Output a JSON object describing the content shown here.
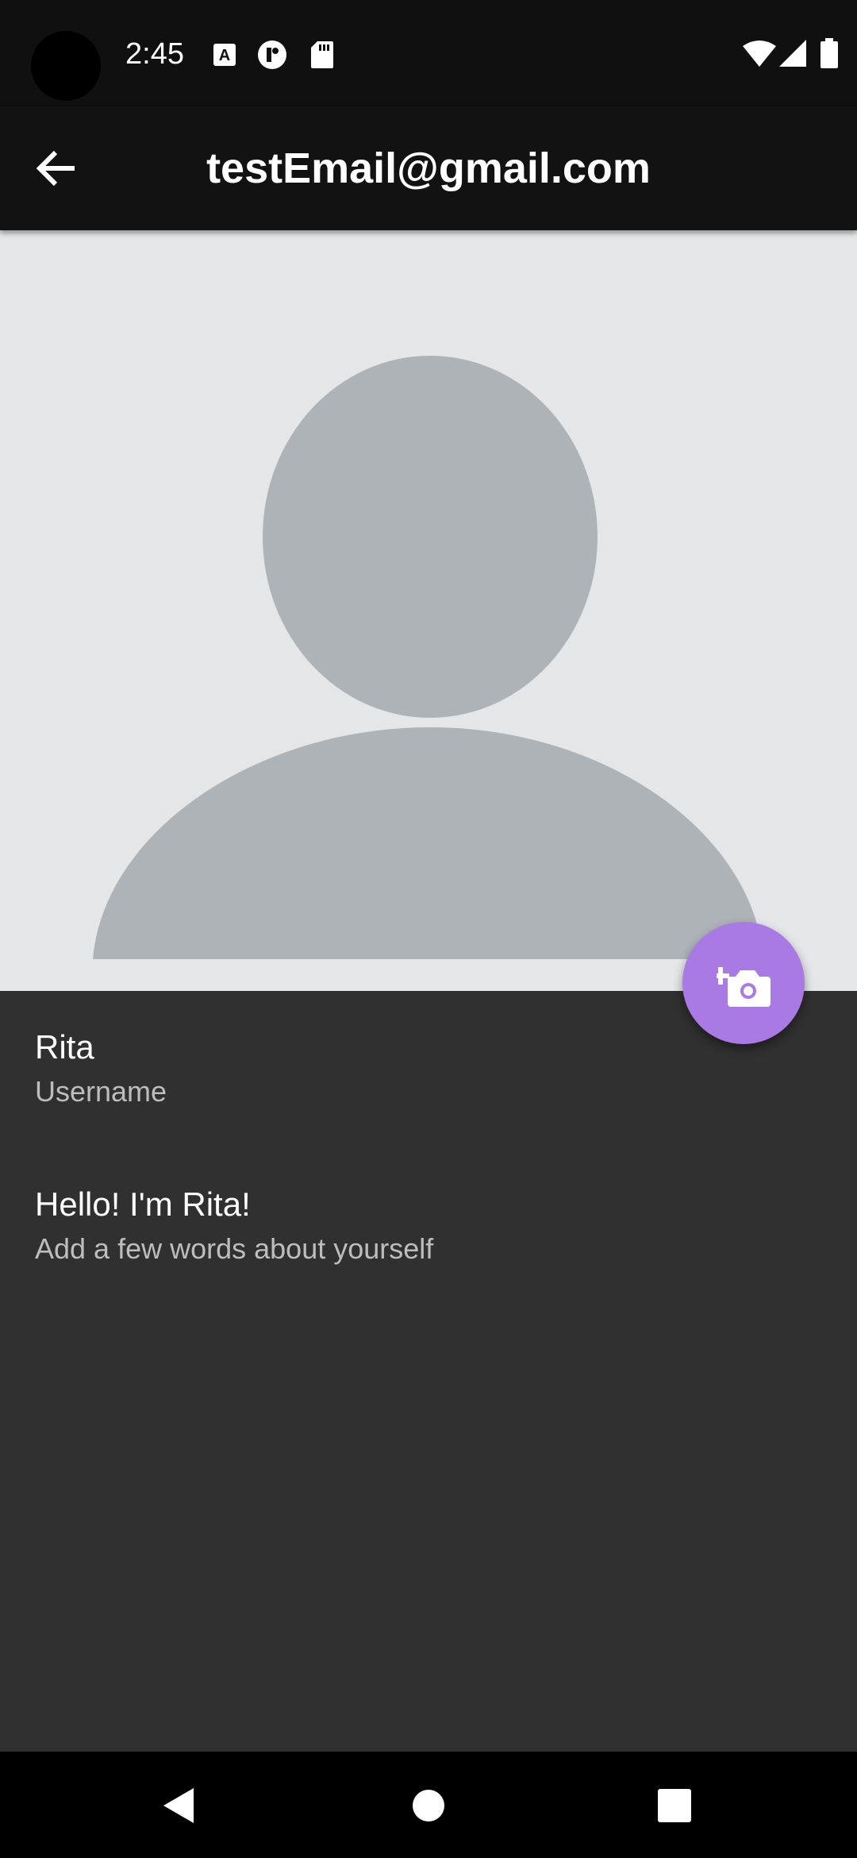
{
  "status_bar": {
    "time": "2:45",
    "icons": [
      "a-notification-icon",
      "circle-notification-icon",
      "sd-card-icon",
      "wifi-icon",
      "signal-icon",
      "battery-icon"
    ]
  },
  "app_bar": {
    "title": "testEmail@gmail.com",
    "back_icon": "arrow-back-icon"
  },
  "avatar": {
    "icon": "person-placeholder-icon",
    "fab_icon": "add-a-photo-icon"
  },
  "profile": {
    "username_value": "Rita",
    "username_label": "Username",
    "bio_value": "Hello! I'm Rita!",
    "bio_label": "Add a few words about yourself"
  },
  "nav_bar": {
    "icons": [
      "nav-back-icon",
      "nav-home-icon",
      "nav-recents-icon"
    ]
  },
  "colors": {
    "status_bar": "#101010",
    "app_bar": "#121212",
    "avatar_bg": "#e4e6e8",
    "avatar_fg": "#aeb3b7",
    "fab": "#a97ae3",
    "content_bg": "#303030"
  }
}
